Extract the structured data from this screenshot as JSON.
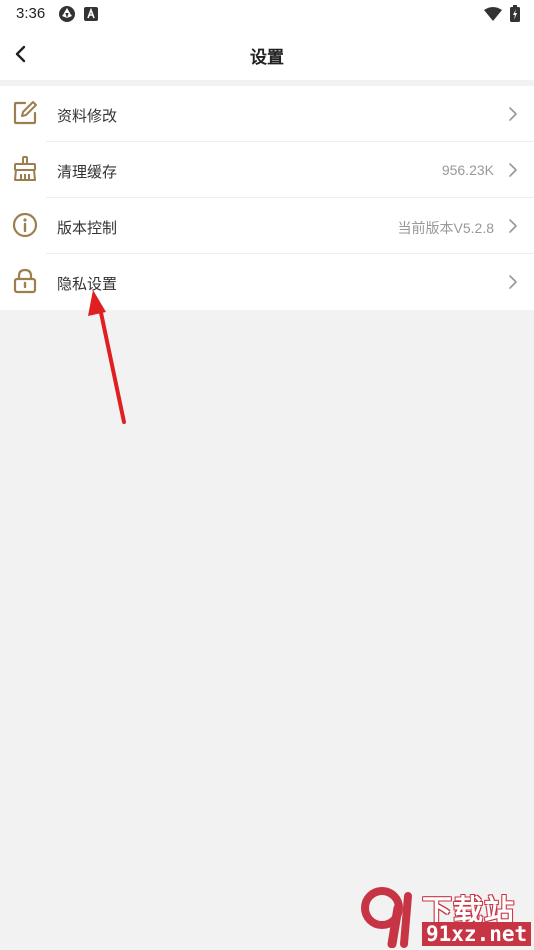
{
  "status_bar": {
    "time": "3:36",
    "left_icons": [
      "aperture-icon",
      "a-badge-icon"
    ],
    "right_icons": [
      "wifi-icon",
      "battery-charging-icon"
    ]
  },
  "nav": {
    "back_icon": "chevron-left-icon",
    "title": "设置"
  },
  "settings": [
    {
      "icon": "edit-icon",
      "label": "资料修改",
      "value": ""
    },
    {
      "icon": "broom-icon",
      "label": "清理缓存",
      "value": "956.23K"
    },
    {
      "icon": "info-icon",
      "label": "版本控制",
      "value": "当前版本V5.2.8"
    },
    {
      "icon": "lock-icon",
      "label": "隐私设置",
      "value": ""
    }
  ],
  "watermark": {
    "logo_text": "9",
    "top_text": "下载站",
    "bottom_text": "91xz.net"
  },
  "colors": {
    "accent": "#9c7f4f",
    "page_background": "#f2f2f2",
    "arrow": "#e02020",
    "watermark": "#c73545"
  }
}
